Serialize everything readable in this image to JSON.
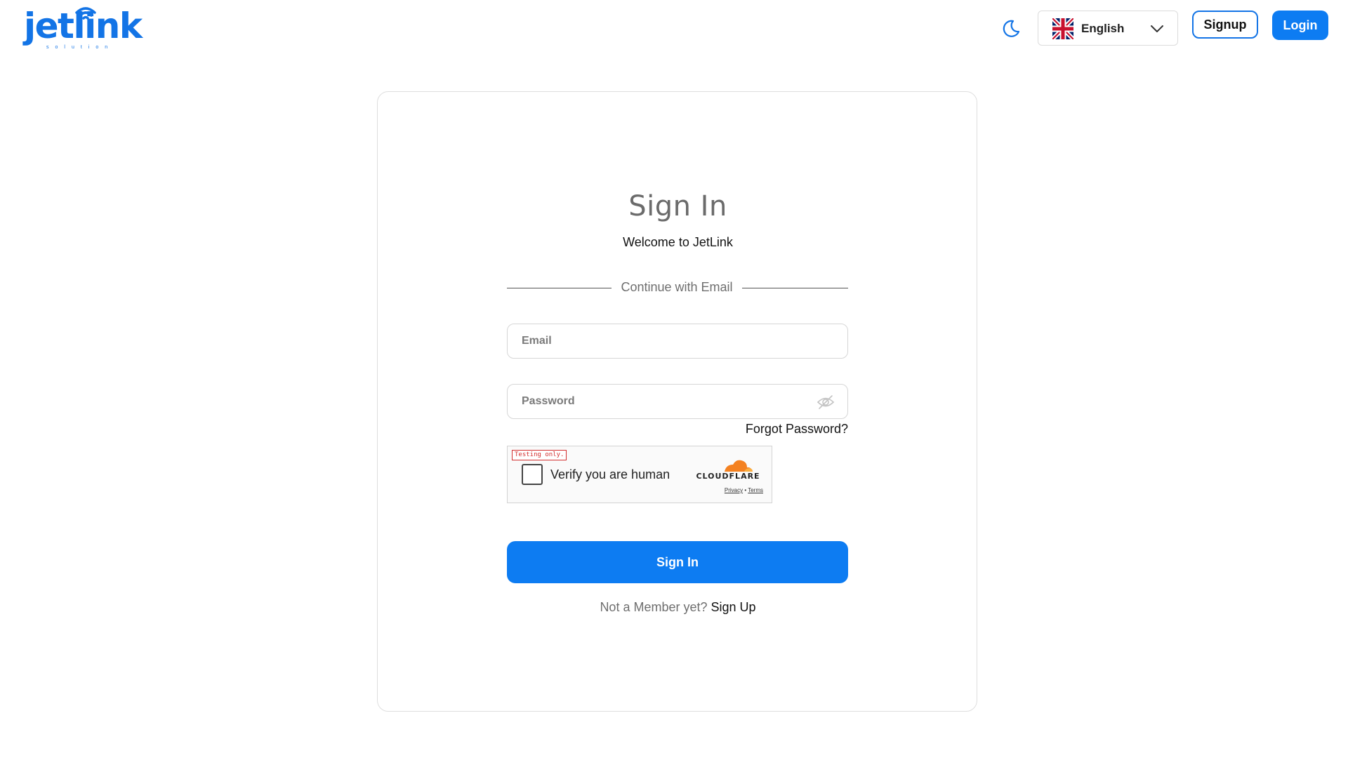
{
  "header": {
    "logo_text": "jetlink",
    "logo_subtext": "solution",
    "language": "English",
    "signup_label": "Signup",
    "login_label": "Login"
  },
  "colors": {
    "brand": "#1374e6",
    "primary_button": "#0d7cf2",
    "cloudflare_orange": "#f48120"
  },
  "icons": [
    "moon-icon",
    "uk-flag-icon",
    "chevron-down-icon",
    "eye-off-icon",
    "cloudflare-logo",
    "wifi-icon"
  ],
  "card": {
    "title": "Sign In",
    "subtitle": "Welcome to JetLink",
    "divider_text": "Continue with Email",
    "email_placeholder": "Email",
    "password_placeholder": "Password",
    "forgot_password": "Forgot Password?",
    "captcha": {
      "testing_label": "Testing only.",
      "label": "Verify you are human",
      "brand": "CLOUDFLARE",
      "privacy": "Privacy",
      "separator": "•",
      "terms": "Terms"
    },
    "signin_button": "Sign In",
    "member_question": "Not a Member yet?",
    "signup_link": "Sign Up"
  }
}
